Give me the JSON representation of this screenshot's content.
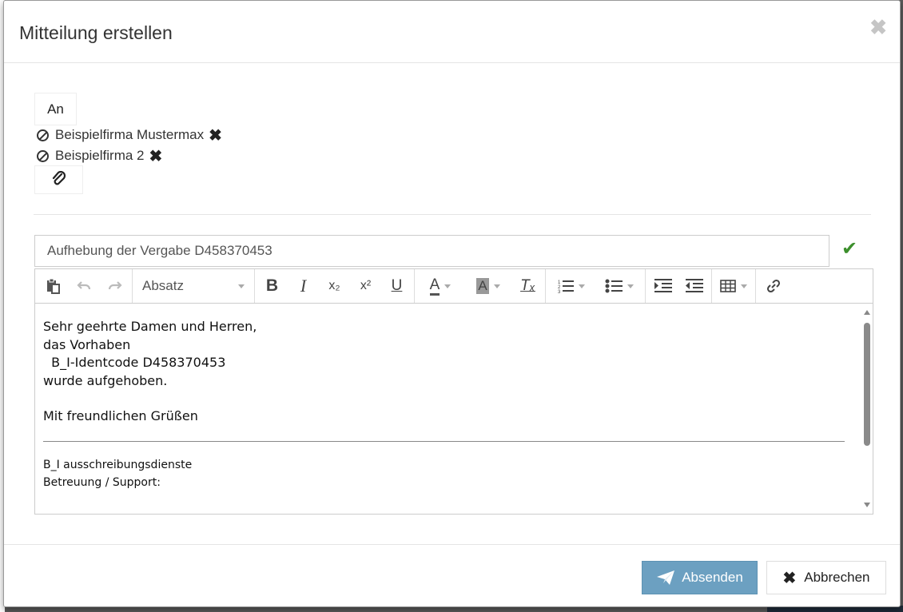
{
  "dialog": {
    "title": "Mitteilung erstellen",
    "close_glyph": "✖"
  },
  "recipients": {
    "button_label": "An",
    "items": [
      {
        "name": "Beispielfirma Mustermax",
        "remove_glyph": "✖"
      },
      {
        "name": "Beispielfirma 2",
        "remove_glyph": "✖"
      }
    ]
  },
  "subject": {
    "value": "Aufhebung der Vergabe D458370453",
    "valid_glyph": "✔"
  },
  "toolbar": {
    "format_value": "Absatz",
    "icons": [
      "paste-icon",
      "undo-icon",
      "redo-icon",
      "bold-icon",
      "italic-icon",
      "subscript-icon",
      "superscript-icon",
      "underline-icon",
      "text-color-icon",
      "background-color-icon",
      "clear-format-icon",
      "numbered-list-icon",
      "bullet-list-icon",
      "indent-icon",
      "outdent-icon",
      "table-icon",
      "link-icon"
    ],
    "glyphs": {
      "bold": "B",
      "italic": "I",
      "subscript": "x₂",
      "superscript": "x²",
      "underline": "U",
      "text_color": "A",
      "bg_color": "A",
      "clear_format": "Tₓ"
    }
  },
  "body": {
    "lines": [
      "Sehr geehrte Damen und Herren,",
      "das Vorhaben",
      "  B_I-Identcode D458370453",
      "wurde aufgehoben.",
      "",
      "Mit freundlichen Grüßen"
    ],
    "signature": [
      "B_I ausschreibungsdienste",
      "Betreuung / Support:"
    ]
  },
  "footer": {
    "send_label": "Absenden",
    "cancel_label": "Abbrechen",
    "cancel_glyph": "✖"
  },
  "colors": {
    "send_button": "#6ca0c1",
    "valid_check": "#3c8f2c"
  }
}
